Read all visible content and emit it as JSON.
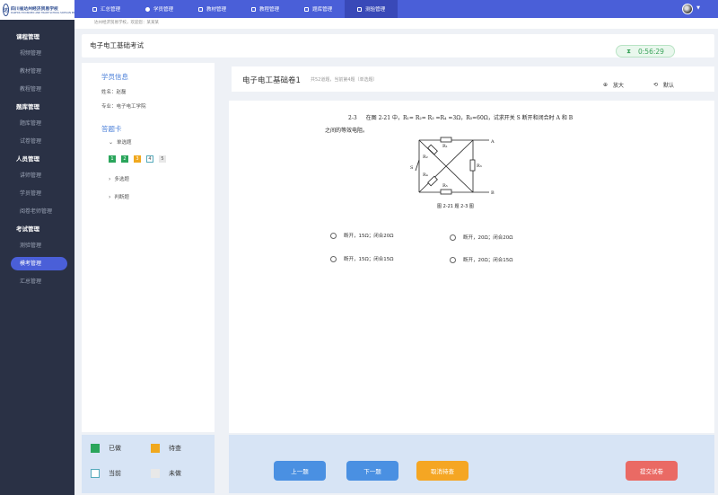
{
  "logo": {
    "cn": "四川省达州经济贸易学校",
    "en": "DAZHOU ECONOMIC AND TRADE SCHOOL SICHUAN PROVINCE"
  },
  "sidebar": {
    "groups": [
      {
        "title": "课程管理",
        "items": [
          "视频管理",
          "教材管理",
          "教程管理"
        ]
      },
      {
        "title": "题库管理",
        "items": [
          "题库管理",
          "试卷管理"
        ]
      },
      {
        "title": "人员管理",
        "items": [
          "讲师管理",
          "学员管理",
          "阅卷老师管理"
        ]
      },
      {
        "title": "考试管理",
        "items": [
          "测验管理",
          "模考管理",
          "汇总管理"
        ]
      }
    ],
    "active_item": "模考管理"
  },
  "topnav": {
    "tabs": [
      {
        "label": "汇总管理",
        "icon": "dashboard-icon"
      },
      {
        "label": "学员管理",
        "icon": "user-icon"
      },
      {
        "label": "教材管理",
        "icon": "book-icon"
      },
      {
        "label": "教程管理",
        "icon": "doc-icon"
      },
      {
        "label": "题库管理",
        "icon": "monitor-icon"
      },
      {
        "label": "测验管理",
        "icon": "chart-icon"
      }
    ],
    "active_tab": "测验管理"
  },
  "breadcrumb": "达州经济贸易学校，欢迎您：某某某",
  "exam": {
    "title": "电子电工基础考试",
    "timer": "0:56:29"
  },
  "student": {
    "section_title": "学员信息",
    "name_line": "姓名：赵磊",
    "major_line": "专业：电子电工学院"
  },
  "answer_card": {
    "title": "答题卡",
    "groups": [
      "单选题",
      "多选题",
      "判断题"
    ],
    "single_choice_numbers": [
      {
        "n": "1",
        "state": "done"
      },
      {
        "n": "2",
        "state": "done"
      },
      {
        "n": "3",
        "state": "pending"
      },
      {
        "n": "4",
        "state": "current"
      },
      {
        "n": "5",
        "state": "undone"
      }
    ]
  },
  "legend": {
    "done": "已做",
    "pending": "待查",
    "current": "当前",
    "undone": "未做"
  },
  "paper": {
    "title": "电子电工基础卷1",
    "meta": "共52道题，当前第4题（单选题）",
    "zoom_label": "放大",
    "default_label": "默认"
  },
  "question": {
    "number": "2-3",
    "text_line1": "在图 2-21 中，R₁= R₂= R₃ =R₄ =3Ω，R₅=60Ω，试求开关 S 断开和闭合时 A 和 B",
    "text_line2": "之间的等效电阻。",
    "figure_caption": "图 2-21    题 2-3 图",
    "circuit_labels": {
      "a": "A",
      "b": "B",
      "s": "S",
      "r1": "R₁",
      "r2": "R₂",
      "r3": "R₃",
      "r4": "R₄",
      "r5": "R₅"
    },
    "options": [
      "断开，15Ω；闭合20Ω",
      "断开，20Ω；闭合20Ω",
      "断开，15Ω；闭合15Ω",
      "断开，20Ω；闭合15Ω"
    ]
  },
  "actions": {
    "prev": "上一题",
    "next": "下一题",
    "cancel_pending": "取消待查",
    "submit": "提交试卷"
  }
}
